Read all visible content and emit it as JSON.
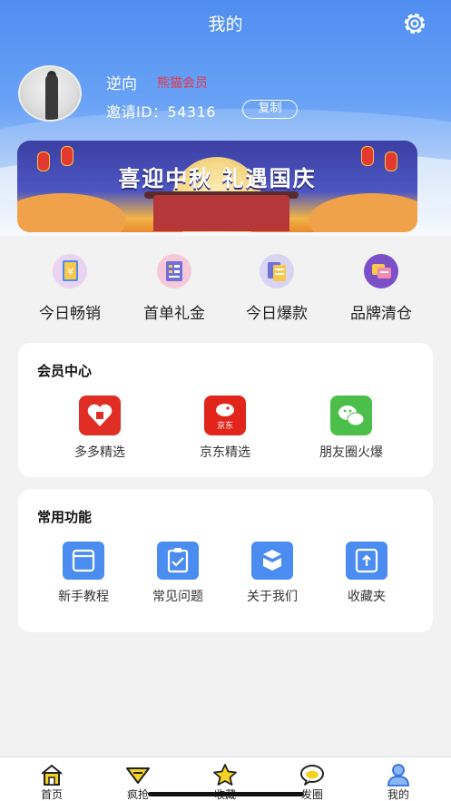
{
  "header": {
    "title": "我的",
    "settings_icon": "gear-icon",
    "username": "逆向",
    "member_tag": "熊猫会员",
    "invite_text": "邀请ID：54316",
    "copy_label": "复制"
  },
  "banner": {
    "text": "喜迎中秋 礼遇国庆"
  },
  "quick_links": [
    {
      "label": "今日畅销",
      "icon": "notebook-yen-icon"
    },
    {
      "label": "首单礼金",
      "icon": "list-card-icon"
    },
    {
      "label": "今日爆款",
      "icon": "documents-icon"
    },
    {
      "label": "品牌清仓",
      "icon": "chat-cards-icon"
    }
  ],
  "member_center": {
    "title": "会员中心",
    "items": [
      {
        "label": "多多精选",
        "icon": "pinduoduo-icon",
        "color": "#e02e24"
      },
      {
        "label": "京东精选",
        "icon": "jd-icon",
        "color": "#e1251b"
      },
      {
        "label": "朋友圈火爆",
        "icon": "wechat-icon",
        "color": "#4cbf4b"
      }
    ]
  },
  "common_functions": {
    "title": "常用功能",
    "items": [
      {
        "label": "新手教程",
        "icon": "window-icon"
      },
      {
        "label": "常见问题",
        "icon": "clipboard-check-icon"
      },
      {
        "label": "关于我们",
        "icon": "box-icon"
      },
      {
        "label": "收藏夹",
        "icon": "upload-box-icon"
      }
    ]
  },
  "tabbar": {
    "items": [
      {
        "label": "首页",
        "icon": "home-icon"
      },
      {
        "label": "疯抢",
        "icon": "tag-icon"
      },
      {
        "label": "收藏",
        "icon": "star-icon"
      },
      {
        "label": "发圈",
        "icon": "chat-bubble-icon"
      },
      {
        "label": "我的",
        "icon": "user-icon"
      }
    ]
  },
  "colors": {
    "header_blue": "#4f8df0",
    "member_tag": "#e6374a",
    "accent_blue": "#4a8cf0",
    "tab_yellow": "#f5d326"
  }
}
